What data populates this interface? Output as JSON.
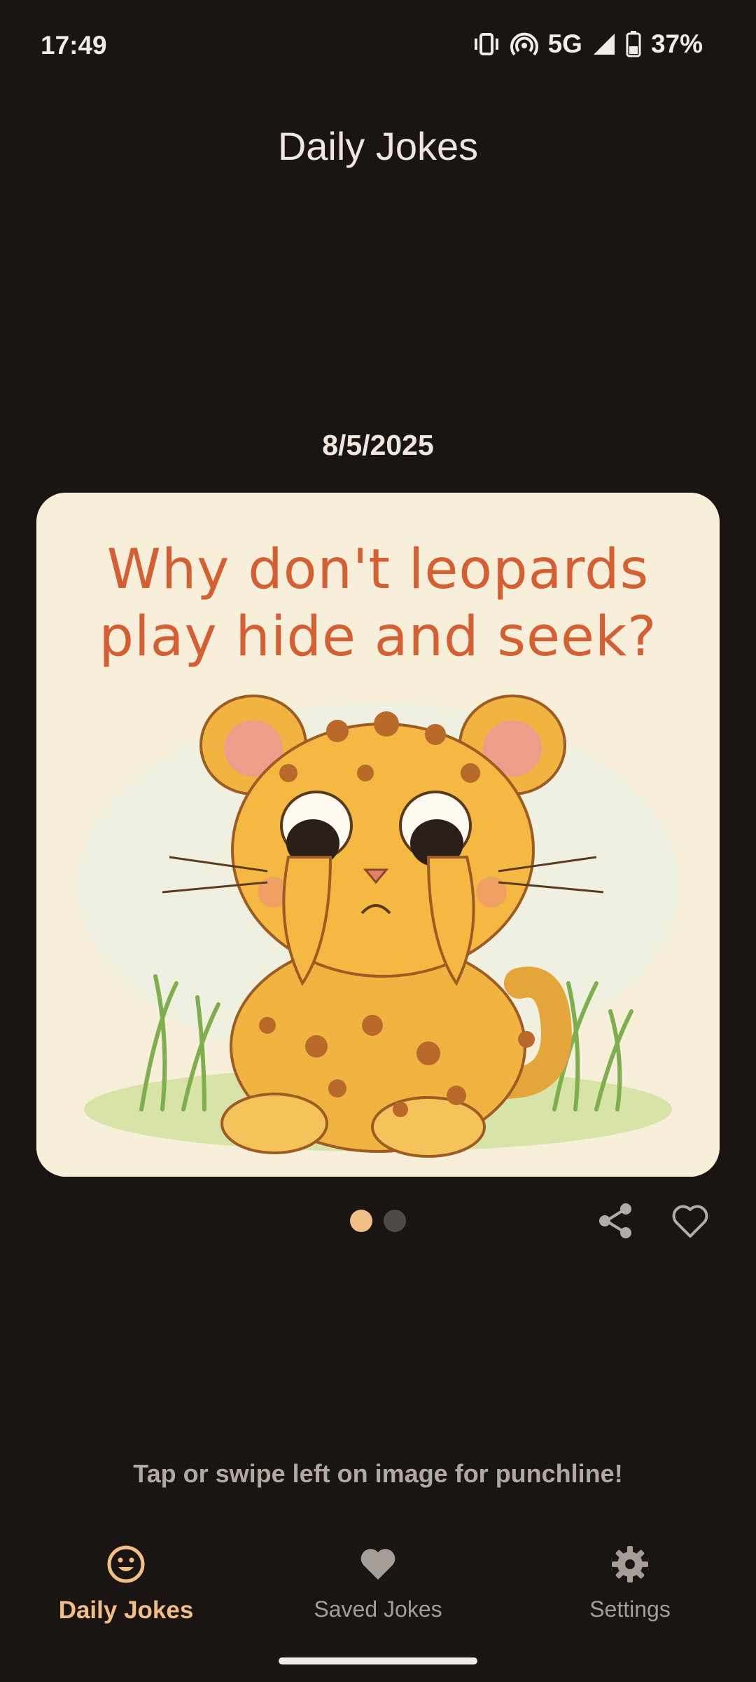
{
  "status_bar": {
    "time": "17:49",
    "network": "5G",
    "battery": "37%",
    "icons": [
      "vibrate-icon",
      "hotspot-icon",
      "signal-icon",
      "battery-icon"
    ]
  },
  "app": {
    "title": "Daily Jokes"
  },
  "joke": {
    "date": "8/5/2025",
    "setup_line1": "Why don't leopards",
    "setup_line2": "play hide and seek?",
    "image_description_icon": "cartoon-leopard-covering-eyes"
  },
  "pager": {
    "current_page": 1,
    "total_pages": 2
  },
  "actions": {
    "share_icon": "share-icon",
    "favorite_icon": "heart-outline-icon"
  },
  "hint": "Tap or swipe left on image for punchline!",
  "bottom_nav": {
    "items": [
      {
        "label": "Daily Jokes",
        "icon": "smiley-icon",
        "active": true
      },
      {
        "label": "Saved Jokes",
        "icon": "heart-icon",
        "active": false
      },
      {
        "label": "Settings",
        "icon": "gear-icon",
        "active": false
      }
    ]
  },
  "colors": {
    "background": "#1a1412",
    "accent": "#f1be86",
    "card": "#f7efd9",
    "joke_text": "#d45f32",
    "muted": "#a49d98"
  }
}
